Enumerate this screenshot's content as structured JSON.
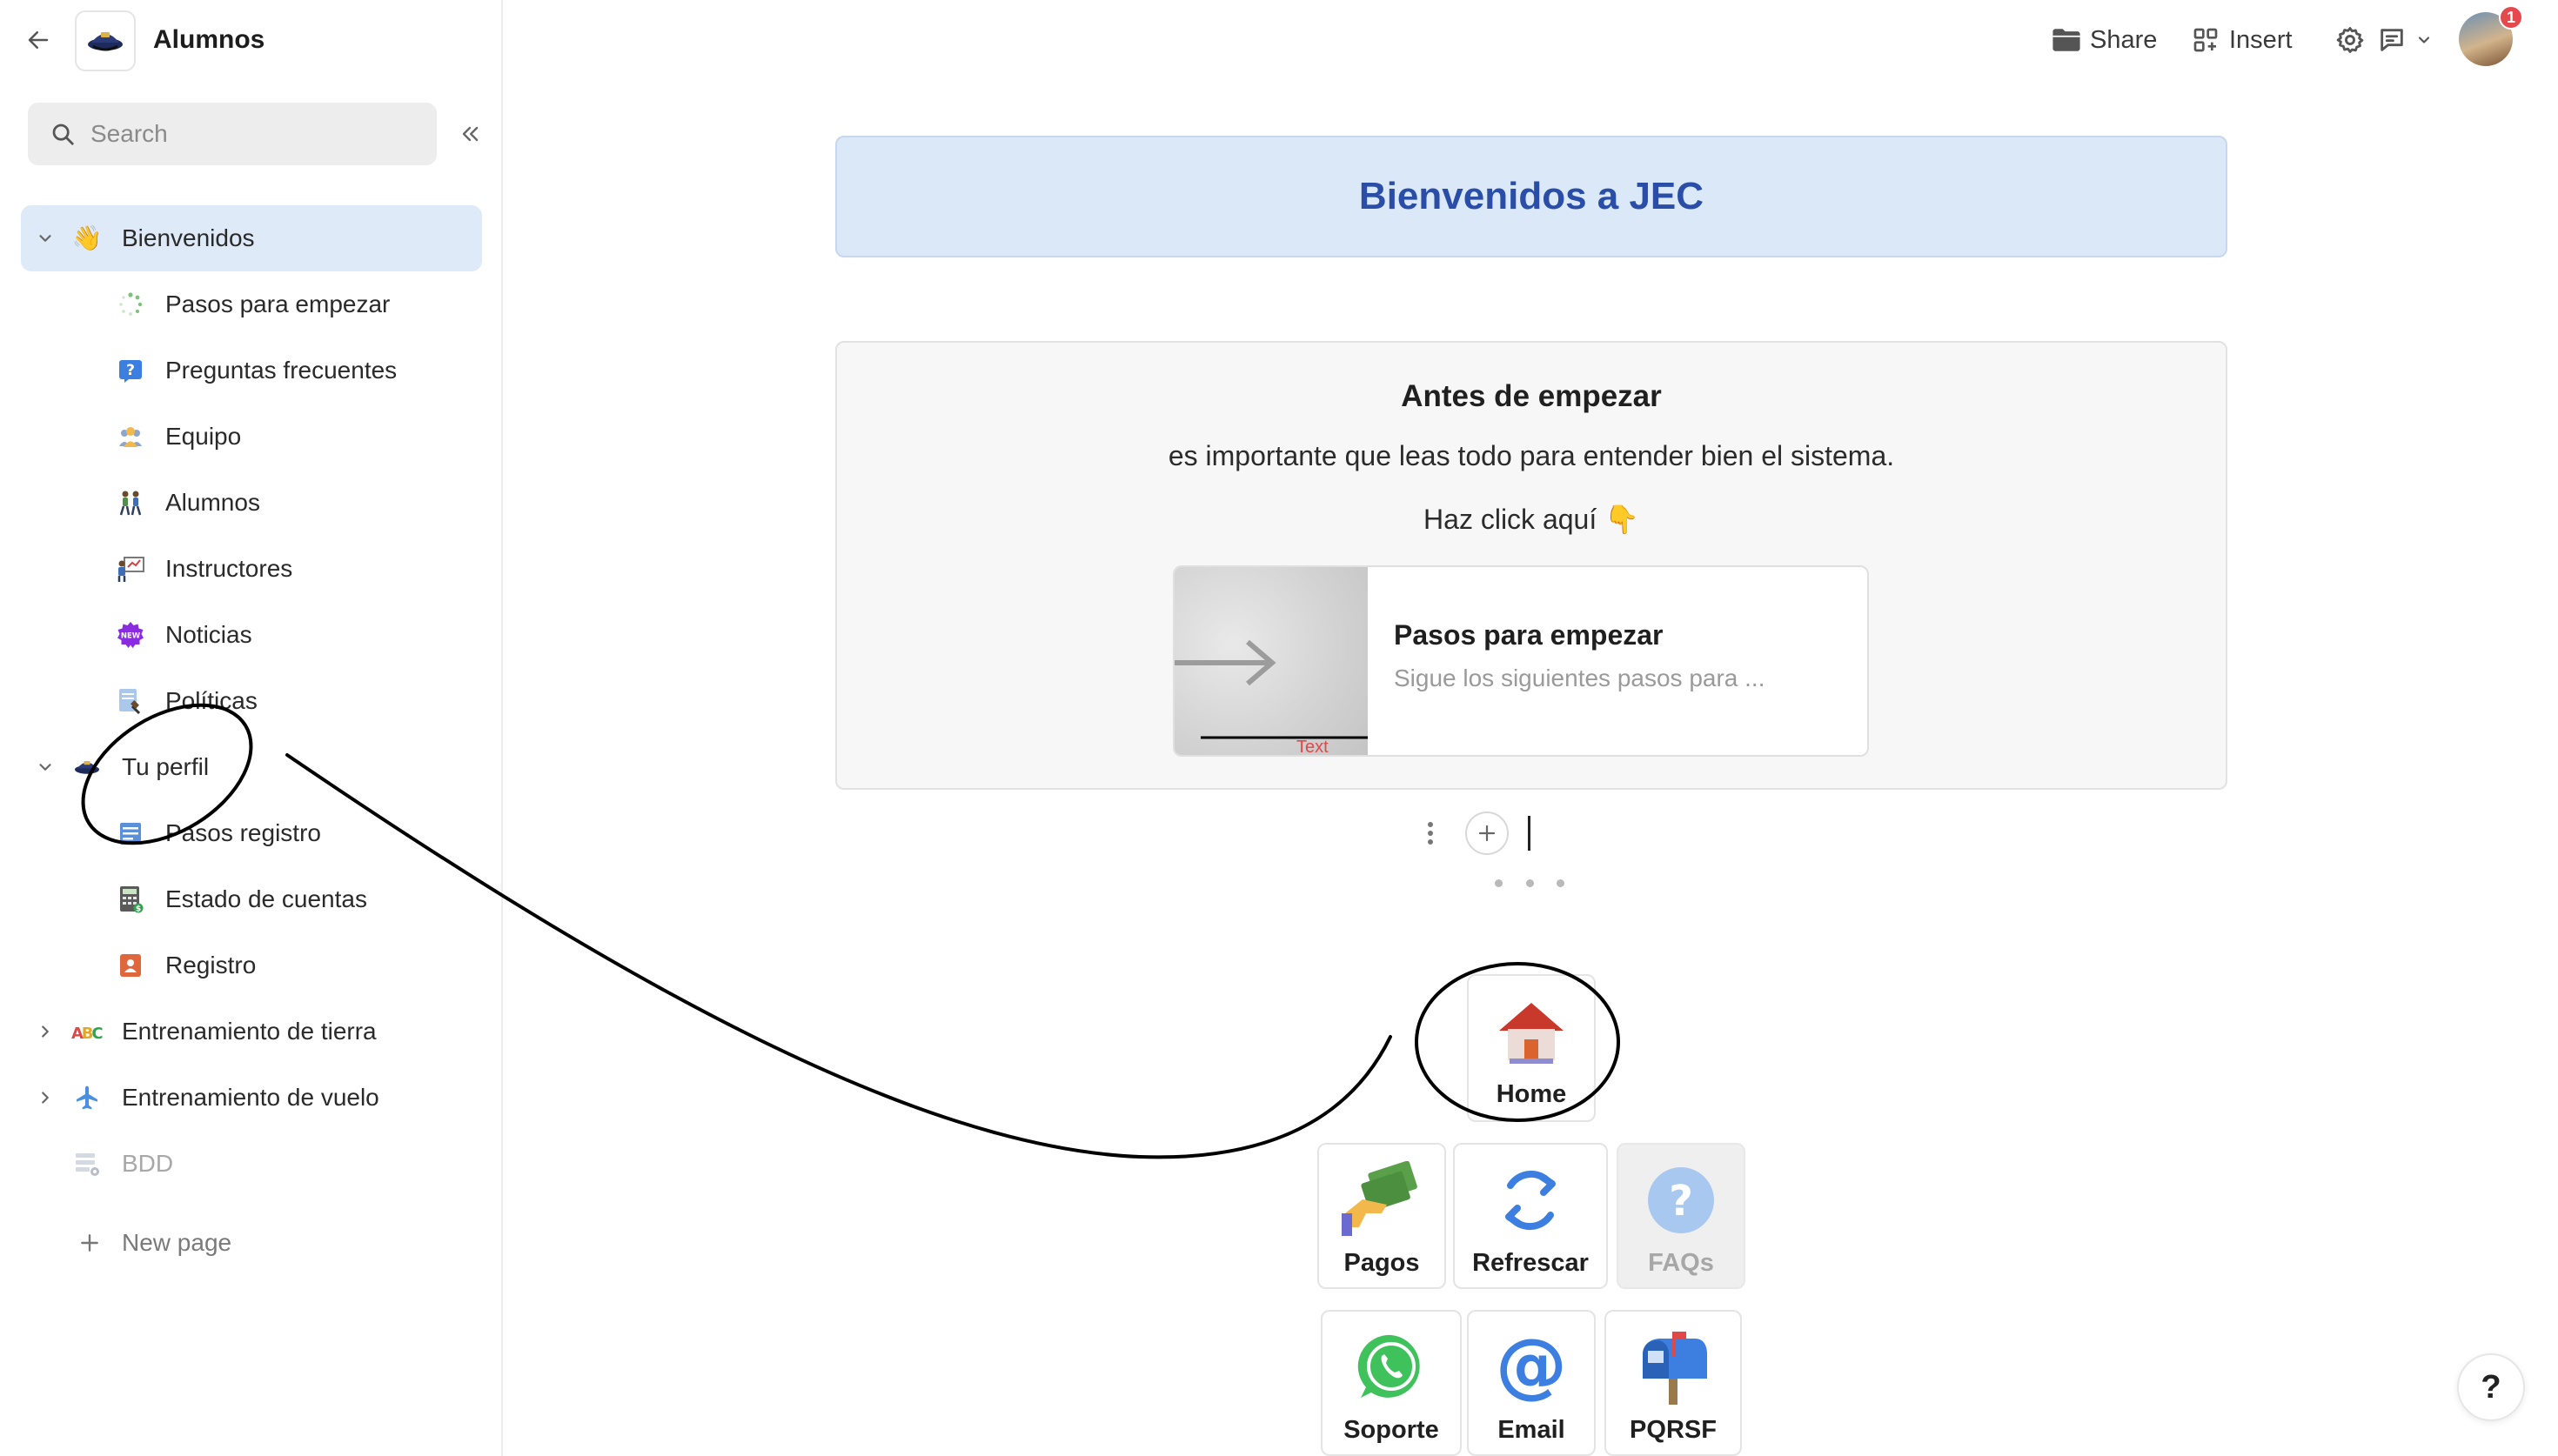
{
  "app": {
    "title": "Alumnos"
  },
  "search": {
    "placeholder": "Search"
  },
  "sidebar": {
    "items": [
      {
        "label": "Bienvenidos",
        "icon": "waving-hand-icon",
        "expanded": true,
        "active": true
      },
      {
        "label": "Pasos para empezar",
        "icon": "loading-dots-icon"
      },
      {
        "label": "Preguntas frecuentes",
        "icon": "question-box-icon"
      },
      {
        "label": "Equipo",
        "icon": "team-icon"
      },
      {
        "label": "Alumnos",
        "icon": "people-walking-icon"
      },
      {
        "label": "Instructores",
        "icon": "teacher-board-icon"
      },
      {
        "label": "Noticias",
        "icon": "new-badge-icon"
      },
      {
        "label": "Políticas",
        "icon": "legal-document-icon"
      },
      {
        "label": "Tu perfil",
        "icon": "pilot-cap-icon",
        "expanded": true
      },
      {
        "label": "Pasos registro",
        "icon": "notepad-icon"
      },
      {
        "label": "Estado de cuentas",
        "icon": "calculator-icon"
      },
      {
        "label": "Registro",
        "icon": "contact-card-icon"
      },
      {
        "label": "Entrenamiento de tierra",
        "icon": "abc-icon",
        "expanded": false
      },
      {
        "label": "Entrenamiento de vuelo",
        "icon": "airplane-icon",
        "expanded": false
      },
      {
        "label": "BDD",
        "icon": "database-icon"
      }
    ],
    "new_page_label": "New page"
  },
  "topbar": {
    "share_label": "Share",
    "insert_label": "Insert",
    "notification_count": "1"
  },
  "main": {
    "hero_title": "Bienvenidos a JEC",
    "callout": {
      "title": "Antes de empezar",
      "text": "es importante que leas todo para entender bien el sistema.",
      "click_text": "Haz click aquí 👇",
      "link_card": {
        "title": "Pasos para empezar",
        "description": "Sigue los siguientes pasos para ...",
        "thumb_caption": "Text"
      }
    },
    "tiles": [
      {
        "label": "Home",
        "icon": "house-icon"
      },
      {
        "label": "Pagos",
        "icon": "money-hand-icon"
      },
      {
        "label": "Refrescar",
        "icon": "refresh-icon"
      },
      {
        "label": "FAQs",
        "icon": "question-icon",
        "disabled": true
      },
      {
        "label": "Soporte",
        "icon": "whatsapp-icon"
      },
      {
        "label": "Email",
        "icon": "at-sign-icon"
      },
      {
        "label": "PQRSF",
        "icon": "mailbox-icon"
      }
    ]
  },
  "help": {
    "label": "?"
  },
  "colors": {
    "accent": "#2a4ea8",
    "hero_bg": "#dbe8f8",
    "active_item_bg": "#deeaf7",
    "badge": "#e5484d"
  }
}
